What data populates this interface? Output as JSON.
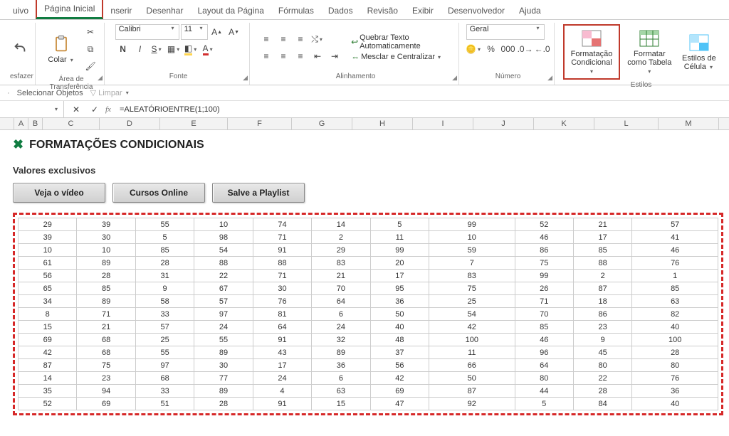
{
  "tabs": {
    "file": "uivo",
    "home": "Página Inicial",
    "insert": "nserir",
    "draw": "Desenhar",
    "layout": "Layout da Página",
    "formulas": "Fórmulas",
    "data": "Dados",
    "review": "Revisão",
    "view": "Exibir",
    "developer": "Desenvolvedor",
    "help": "Ajuda"
  },
  "ribbon": {
    "undo_label": "esfazer",
    "paste_label": "Colar",
    "clipboard_group": "Área de Transferência",
    "font_name": "Calibri",
    "font_size": "11",
    "font_group": "Fonte",
    "wrap_text": "Quebrar Texto Automaticamente",
    "merge_center": "Mesclar e Centralizar",
    "alignment_group": "Alinhamento",
    "number_format": "Geral",
    "number_group": "Número",
    "cond_format": "Formatação Condicional",
    "format_table": "Formatar como Tabela",
    "cell_styles": "Estilos de Célula",
    "styles_group": "Estilos"
  },
  "secondary": {
    "select_objects": "Selecionar Objetos",
    "clear": "Limpar"
  },
  "formula": {
    "namebox": "",
    "value": "=ALEATÓRIOENTRE(1;100)"
  },
  "columns": [
    "A",
    "B",
    "C",
    "D",
    "E",
    "F",
    "G",
    "H",
    "I",
    "J",
    "K",
    "L",
    "M"
  ],
  "sheet": {
    "title": "FORMATAÇÕES CONDICIONAIS",
    "subtitle": "Valores exclusivos",
    "buttons": {
      "video": "Veja o vídeo",
      "courses": "Cursos Online",
      "playlist": "Salve a Playlist"
    }
  },
  "chart_data": {
    "type": "table",
    "rows": [
      [
        29,
        39,
        55,
        10,
        74,
        14,
        5,
        99,
        52,
        21,
        57
      ],
      [
        39,
        30,
        5,
        98,
        71,
        2,
        11,
        10,
        46,
        17,
        41
      ],
      [
        10,
        10,
        85,
        54,
        91,
        29,
        99,
        59,
        86,
        85,
        46
      ],
      [
        61,
        89,
        28,
        88,
        88,
        83,
        20,
        7,
        75,
        88,
        76
      ],
      [
        56,
        28,
        31,
        22,
        71,
        21,
        17,
        83,
        99,
        2,
        1
      ],
      [
        65,
        85,
        9,
        67,
        30,
        70,
        95,
        75,
        26,
        87,
        85
      ],
      [
        34,
        89,
        58,
        57,
        76,
        64,
        36,
        25,
        71,
        18,
        63
      ],
      [
        8,
        71,
        33,
        97,
        81,
        6,
        50,
        54,
        70,
        86,
        82
      ],
      [
        15,
        21,
        57,
        24,
        64,
        24,
        40,
        42,
        85,
        23,
        40
      ],
      [
        69,
        68,
        25,
        55,
        91,
        32,
        48,
        100,
        46,
        9,
        100
      ],
      [
        42,
        68,
        55,
        89,
        43,
        89,
        37,
        11,
        96,
        45,
        28
      ],
      [
        87,
        75,
        97,
        30,
        17,
        36,
        56,
        66,
        64,
        80,
        80
      ],
      [
        14,
        23,
        68,
        77,
        24,
        6,
        42,
        50,
        80,
        22,
        76
      ],
      [
        35,
        94,
        33,
        89,
        4,
        63,
        69,
        87,
        44,
        28,
        36
      ],
      [
        52,
        69,
        51,
        28,
        91,
        15,
        47,
        92,
        5,
        84,
        40
      ]
    ]
  }
}
